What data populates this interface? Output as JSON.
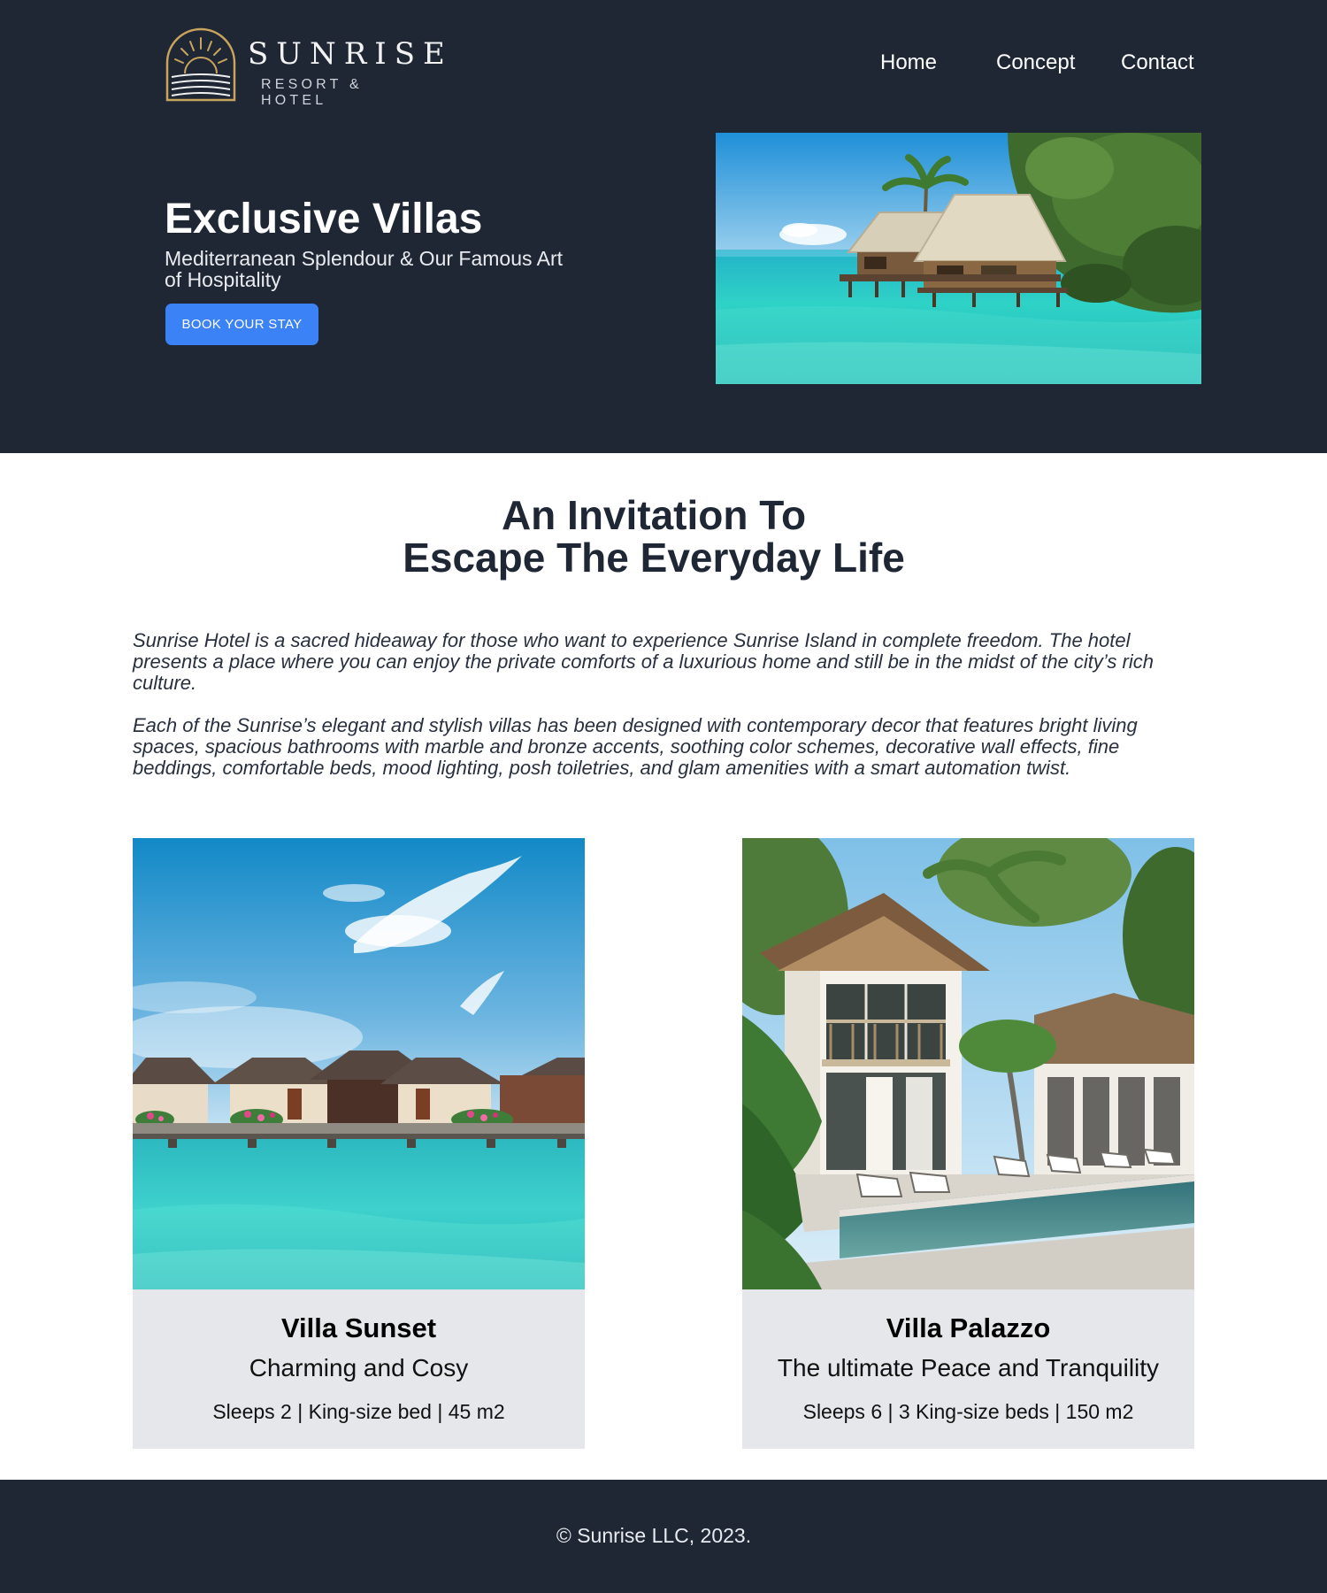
{
  "brand": {
    "name": "SUNRISE",
    "tagline": "RESORT & HOTEL",
    "accent_color": "#c9a45c"
  },
  "nav": {
    "items": [
      {
        "label": "Home"
      },
      {
        "label": "Concept"
      },
      {
        "label": "Contact"
      }
    ]
  },
  "hero": {
    "title": "Exclusive Villas",
    "subtitle": "Mediterranean Splendour & Our Famous Art of Hospitality",
    "cta_label": "BOOK YOUR STAY",
    "image_icon": "overwater-bungalow-photo"
  },
  "intro": {
    "title_line1": "An Invitation To",
    "title_line2": "Escape The Everyday Life",
    "paragraph1": "Sunrise Hotel is a sacred hideaway for those who want to experience Sunrise Island in complete freedom. The hotel presents a place where you can enjoy the private comforts of a luxurious home and still be in the midst of the city’s rich culture.",
    "paragraph2": "Each of the Sunrise’s elegant and stylish villas has been designed with contemporary decor that features bright living spaces, spacious bathrooms with marble and bronze accents, soothing color schemes, decorative wall effects, fine beddings, comfortable beds, mood lighting, posh toiletries, and glam amenities with a smart automation twist."
  },
  "villas": [
    {
      "name": "Villa Sunset",
      "tagline": "Charming and Cosy",
      "specs": "Sleeps 2 | King-size bed | 45 m2",
      "image_icon": "water-villas-photo"
    },
    {
      "name": "Villa Palazzo",
      "tagline": "The ultimate Peace and Tranquility",
      "specs": "Sleeps 6 | 3 King-size beds | 150 m2",
      "image_icon": "pool-villa-photo"
    }
  ],
  "footer": {
    "copyright": "© Sunrise LLC, 2023."
  },
  "colors": {
    "dark_navy": "#1f2735",
    "button_blue": "#3b82f6",
    "card_gray": "#e5e7ea"
  }
}
